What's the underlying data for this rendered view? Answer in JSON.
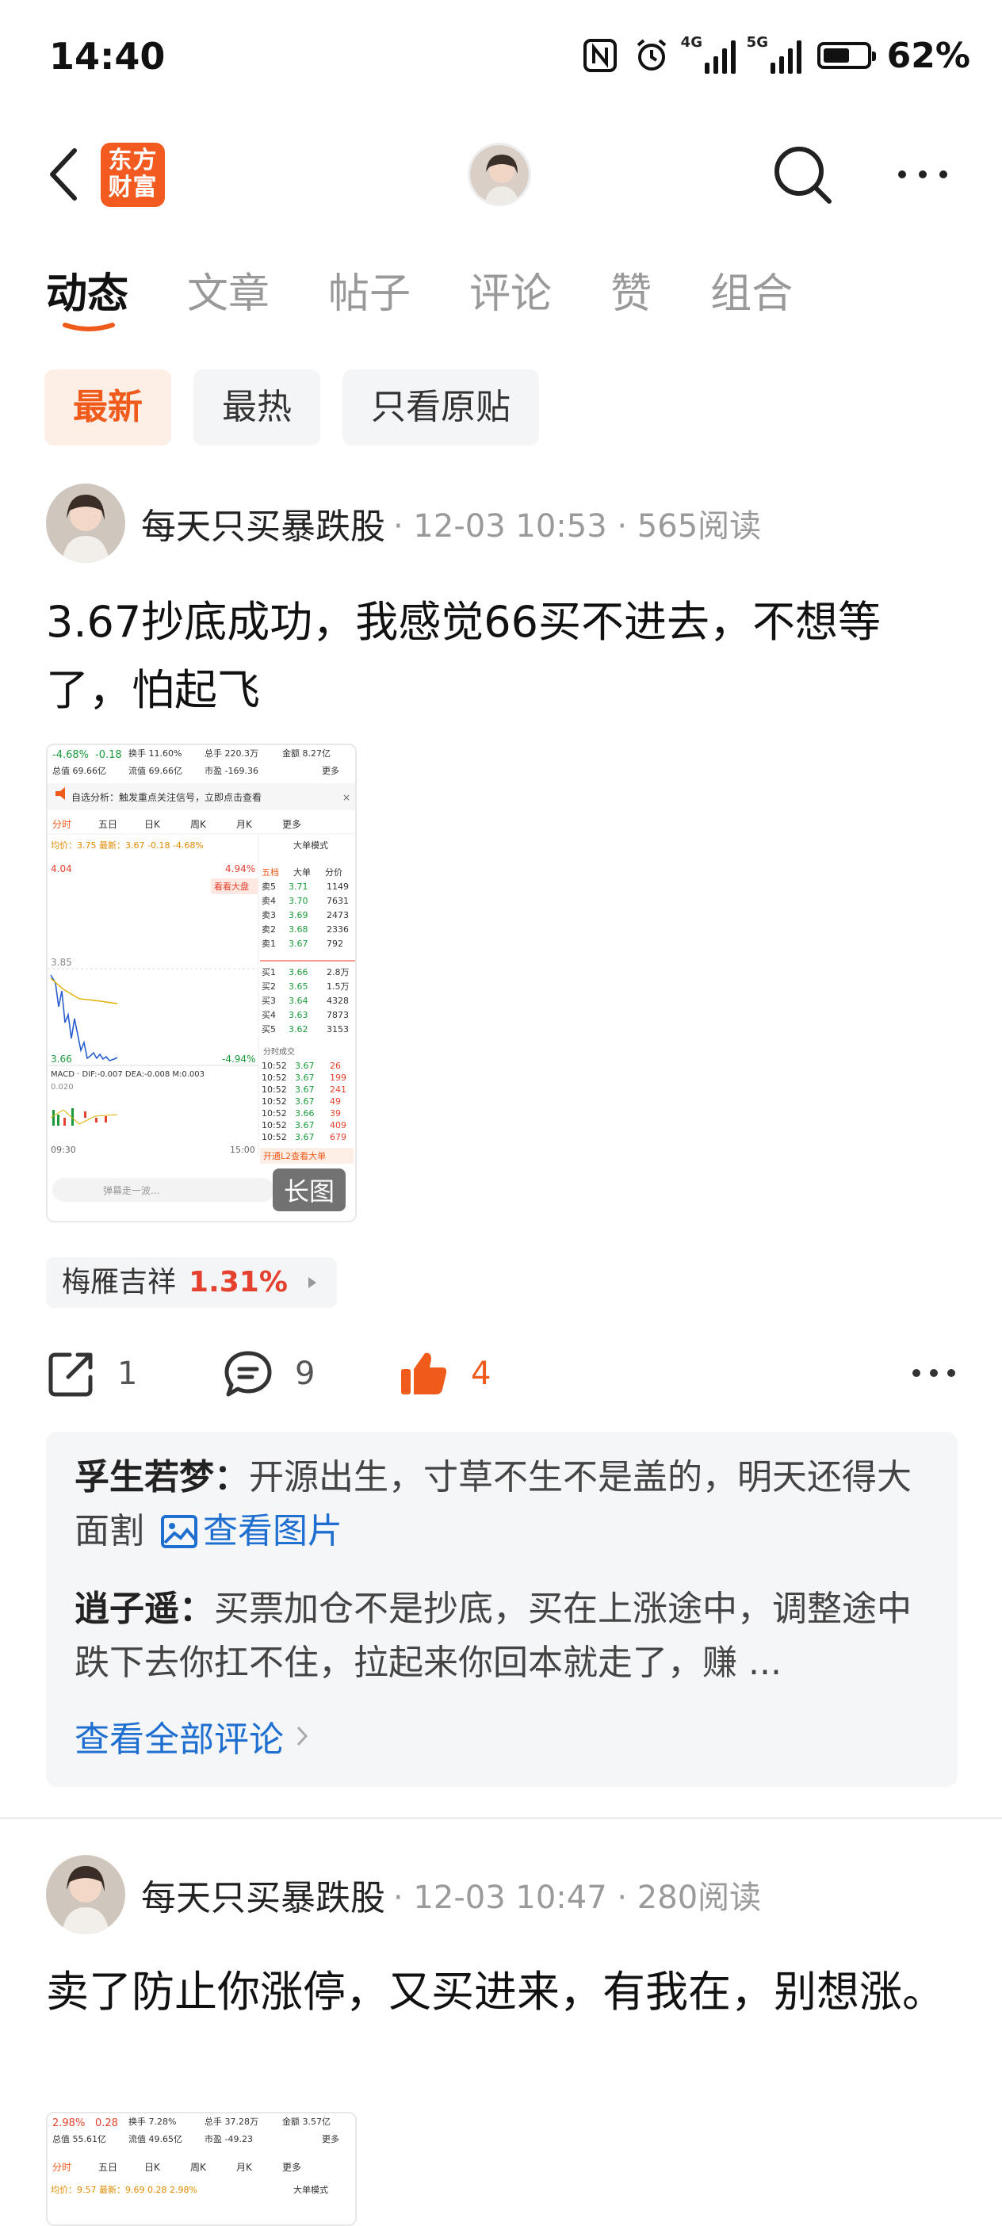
{
  "status_bar": {
    "time": "14:40",
    "network_1": "4G",
    "network_2": "5G",
    "battery": "62%",
    "battery_level": 0.62,
    "icons": [
      "nfc-icon",
      "alarm-icon",
      "signal-icon",
      "battery-icon"
    ]
  },
  "nav": {
    "logo_line1": "东方",
    "logo_line2": "财富",
    "brand_color": "#f25a1f",
    "icons": [
      "back-icon",
      "search-icon",
      "more-icon"
    ]
  },
  "tabs": [
    {
      "label": "动态",
      "active": true
    },
    {
      "label": "文章",
      "active": false
    },
    {
      "label": "帖子",
      "active": false
    },
    {
      "label": "评论",
      "active": false
    },
    {
      "label": "赞",
      "active": false
    },
    {
      "label": "组合",
      "active": false
    }
  ],
  "filters": [
    {
      "label": "最新",
      "active": true
    },
    {
      "label": "最热",
      "active": false
    },
    {
      "label": "只看原贴",
      "active": false
    }
  ],
  "posts": [
    {
      "author": "每天只买暴跌股",
      "meta": "· 12-03 10:53 · 565阅读",
      "text": "3.67抄底成功，我感觉66买不进去，不想等了，怕起飞",
      "image": {
        "change": "-4.68%",
        "change_abs": "-0.18",
        "turnover_label": "换手",
        "turnover": "11.60%",
        "volume_label": "总手",
        "volume": "220.3万",
        "amount_label": "金额",
        "amount": "8.27亿",
        "mcap_label": "总值",
        "mcap": "69.66亿",
        "float_label": "流值",
        "float": "69.66亿",
        "pe_label": "市盈",
        "pe": "-169.36",
        "more": "更多",
        "notice": "自选分析：触发重点关注信号，立即点击查看",
        "chart_tabs": [
          "分时",
          "五日",
          "日K",
          "周K",
          "月K",
          "更多"
        ],
        "avg_line": "均价：3.75  最新：3.67  -0.18  -4.68%",
        "mode": "大单模式",
        "price_top": "4.04",
        "price_mid": "3.85",
        "price_low": "3.66",
        "pct_top": "4.94%",
        "pct_low": "-4.94%",
        "watch_big": "看看大盘",
        "order_tabs": [
          "五档",
          "大单",
          "分价"
        ],
        "asks": [
          {
            "label": "卖5",
            "price": "3.71",
            "vol": "1149"
          },
          {
            "label": "卖4",
            "price": "3.70",
            "vol": "7631"
          },
          {
            "label": "卖3",
            "price": "3.69",
            "vol": "2473"
          },
          {
            "label": "卖2",
            "price": "3.68",
            "vol": "2336"
          },
          {
            "label": "卖1",
            "price": "3.67",
            "vol": "792"
          }
        ],
        "bids": [
          {
            "label": "买1",
            "price": "3.66",
            "vol": "2.8万"
          },
          {
            "label": "买2",
            "price": "3.65",
            "vol": "1.5万"
          },
          {
            "label": "买3",
            "price": "3.64",
            "vol": "4328"
          },
          {
            "label": "买4",
            "price": "3.63",
            "vol": "7873"
          },
          {
            "label": "买5",
            "price": "3.62",
            "vol": "3153"
          }
        ],
        "ticks_header": "分时成交",
        "ticks": [
          {
            "t": "10:52",
            "p": "3.67",
            "v": "26"
          },
          {
            "t": "10:52",
            "p": "3.67",
            "v": "199"
          },
          {
            "t": "10:52",
            "p": "3.67",
            "v": "241"
          },
          {
            "t": "10:52",
            "p": "3.67",
            "v": "49"
          },
          {
            "t": "10:52",
            "p": "3.66",
            "v": "39"
          },
          {
            "t": "10:52",
            "p": "3.67",
            "v": "409"
          },
          {
            "t": "10:52",
            "p": "3.67",
            "v": "679"
          }
        ],
        "macd": "MACD · DIF:-0.007  DEA:-0.008  M:0.003",
        "macd_val": "0.020",
        "time_start": "09:30",
        "time_end": "15:00",
        "l2": "开通L2查看大单",
        "danmaku": "弹幕走一波...",
        "long_label": "长图"
      },
      "stock": {
        "name": "梅雁吉祥",
        "pct": "1.31%"
      },
      "share_count": "1",
      "comment_count": "9",
      "like_count": "4",
      "comments": [
        {
          "name": "孚生若梦：",
          "text": "开源出生，寸草不生不是盖的，明天还得大面割",
          "link": "查看图片"
        },
        {
          "name": "逍子遥：",
          "text": "买票加仓不是抄底，买在上涨途中，调整途中跌下去你扛不住，拉起来你回本就走了，赚 ..."
        }
      ],
      "see_all": "查看全部评论"
    },
    {
      "author": "每天只买暴跌股",
      "meta": "· 12-03 10:47 · 280阅读",
      "text": "卖了防止你涨停，又买进来，有我在，别想涨。",
      "image": {
        "change": "2.98%",
        "change_abs": "0.28",
        "turnover_label": "换手",
        "turnover": "7.28%",
        "volume_label": "总手",
        "volume": "37.28万",
        "amount_label": "金额",
        "amount": "3.57亿",
        "mcap_label": "总值",
        "mcap": "55.61亿",
        "float_label": "流值",
        "float": "49.65亿",
        "pe_label": "市盈",
        "pe": "-49.23",
        "more": "更多",
        "chart_tabs": [
          "分时",
          "五日",
          "日K",
          "周K",
          "月K",
          "更多"
        ],
        "avg_line": "均价：9.57  最新：9.69  0.28  2.98%",
        "mode": "大单模式"
      }
    }
  ]
}
